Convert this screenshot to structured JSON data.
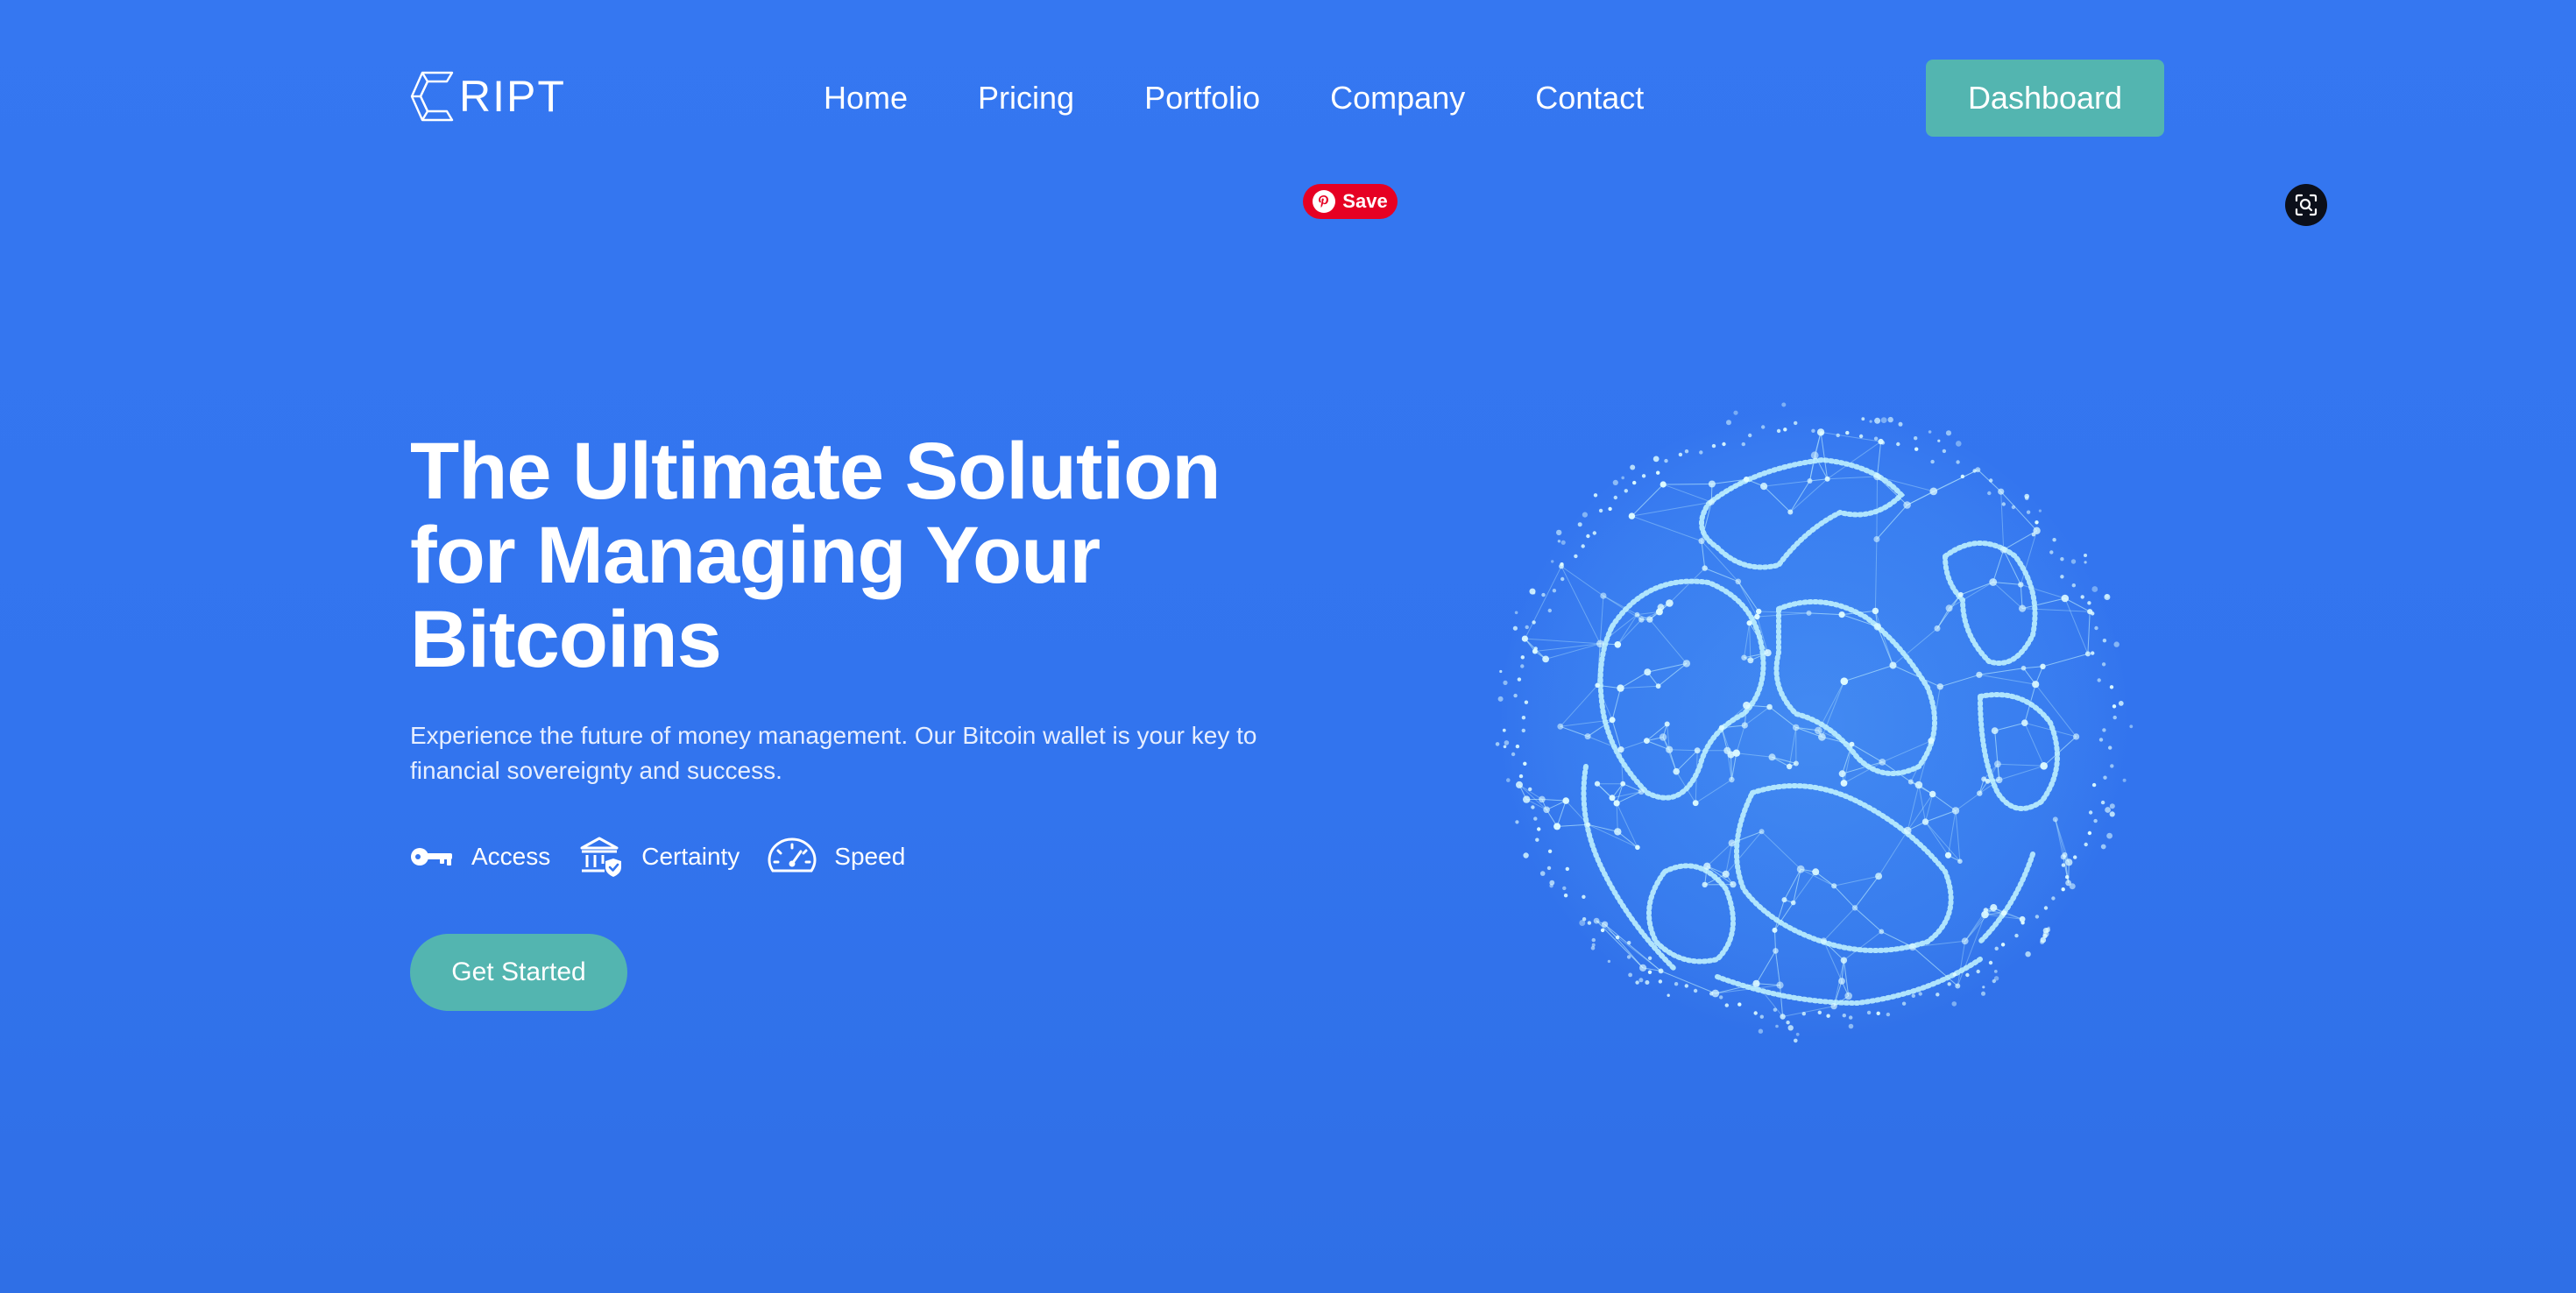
{
  "header": {
    "logo_text": "RIPT",
    "logo_letter": "C",
    "nav": [
      {
        "label": "Home"
      },
      {
        "label": "Pricing"
      },
      {
        "label": "Portfolio"
      },
      {
        "label": "Company"
      },
      {
        "label": "Contact"
      }
    ],
    "dashboard_label": "Dashboard"
  },
  "overlays": {
    "pinterest_save_label": "Save",
    "lens_icon": "visual-search-icon"
  },
  "hero": {
    "title": "The Ultimate Solution for Managing Your Bitcoins",
    "subtitle": "Experience the future of money management. Our Bitcoin wallet is your key to financial sovereignty and success.",
    "features": [
      {
        "label": "Access",
        "icon": "key-icon"
      },
      {
        "label": "Certainty",
        "icon": "bank-shield-icon"
      },
      {
        "label": "Speed",
        "icon": "speedometer-icon"
      }
    ],
    "cta_label": "Get Started",
    "image": "network-globe-illustration"
  },
  "colors": {
    "background": "#3476f0",
    "accent": "#53b5b0",
    "text": "#ffffff",
    "globe": "#bff3ff"
  }
}
